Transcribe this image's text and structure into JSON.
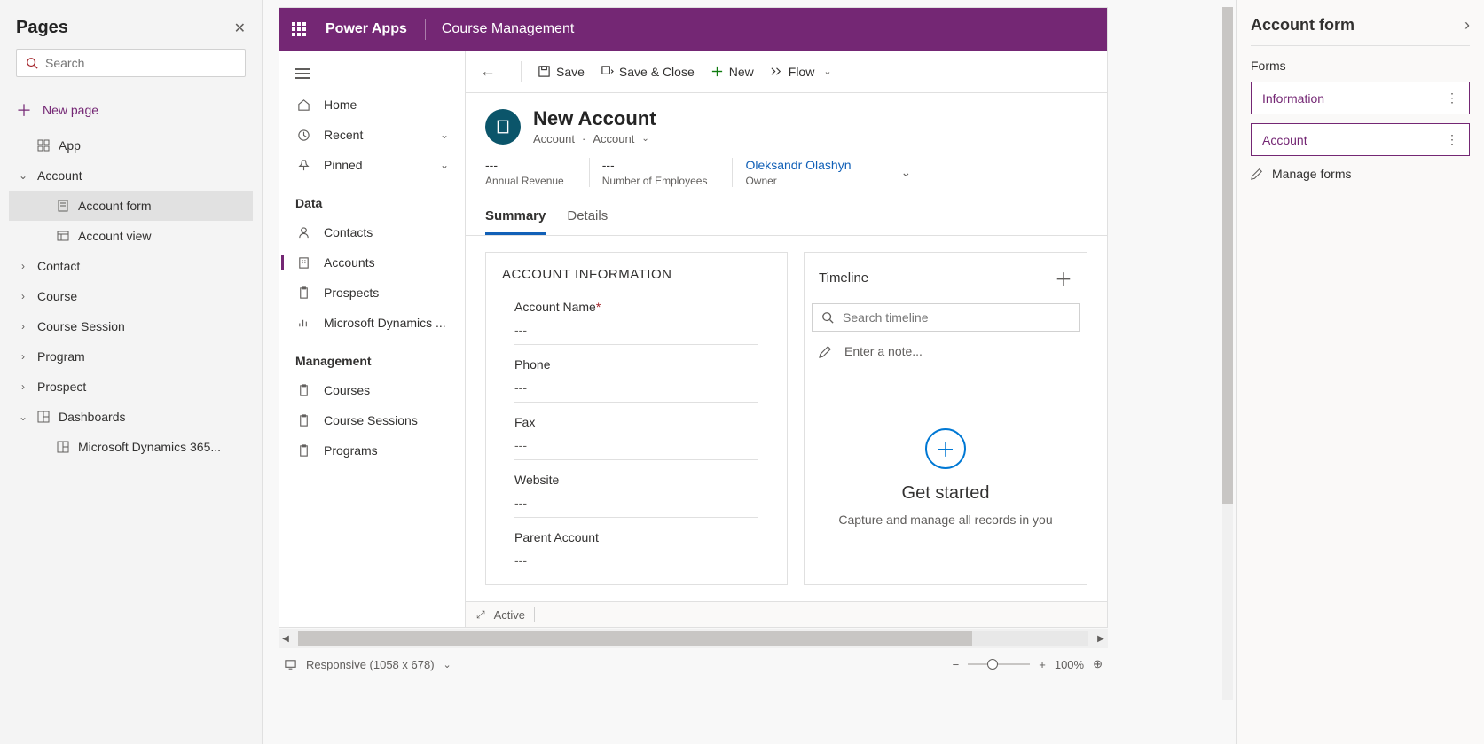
{
  "leftPanel": {
    "title": "Pages",
    "searchPlaceholder": "Search",
    "newPage": "New page",
    "tree": {
      "app": "App",
      "account": "Account",
      "accountForm": "Account form",
      "accountView": "Account view",
      "contact": "Contact",
      "course": "Course",
      "courseSession": "Course Session",
      "program": "Program",
      "prospect": "Prospect",
      "dashboards": "Dashboards",
      "dashboard1": "Microsoft Dynamics 365..."
    }
  },
  "canvas": {
    "powerApps": "Power Apps",
    "appName": "Course Management",
    "nav": {
      "home": "Home",
      "recent": "Recent",
      "pinned": "Pinned",
      "data": "Data",
      "contacts": "Contacts",
      "accounts": "Accounts",
      "prospects": "Prospects",
      "dynamics": "Microsoft Dynamics ...",
      "management": "Management",
      "courses": "Courses",
      "courseSessions": "Course Sessions",
      "programs": "Programs"
    },
    "cmd": {
      "save": "Save",
      "saveClose": "Save & Close",
      "new": "New",
      "flow": "Flow"
    },
    "record": {
      "title": "New Account",
      "entity": "Account",
      "type": "Account",
      "kpiDash": "---",
      "revenueLabel": "Annual Revenue",
      "employeesLabel": "Number of Employees",
      "owner": "Oleksandr Olashyn",
      "ownerLabel": "Owner"
    },
    "tabs": {
      "summary": "Summary",
      "details": "Details"
    },
    "section": {
      "title": "ACCOUNT INFORMATION",
      "accountName": "Account Name",
      "phone": "Phone",
      "fax": "Fax",
      "website": "Website",
      "parent": "Parent Account",
      "emptyVal": "---"
    },
    "timeline": {
      "title": "Timeline",
      "searchPlaceholder": "Search timeline",
      "notePlaceholder": "Enter a note...",
      "emptyTitle": "Get started",
      "emptyText": "Capture and manage all records in you"
    },
    "statusFooter": "Active"
  },
  "bottomBar": {
    "mode": "Responsive (1058 x 678)",
    "zoom": "100%"
  },
  "rightPanel": {
    "title": "Account form",
    "formsLabel": "Forms",
    "formInfo": "Information",
    "formAccount": "Account",
    "manage": "Manage forms"
  }
}
